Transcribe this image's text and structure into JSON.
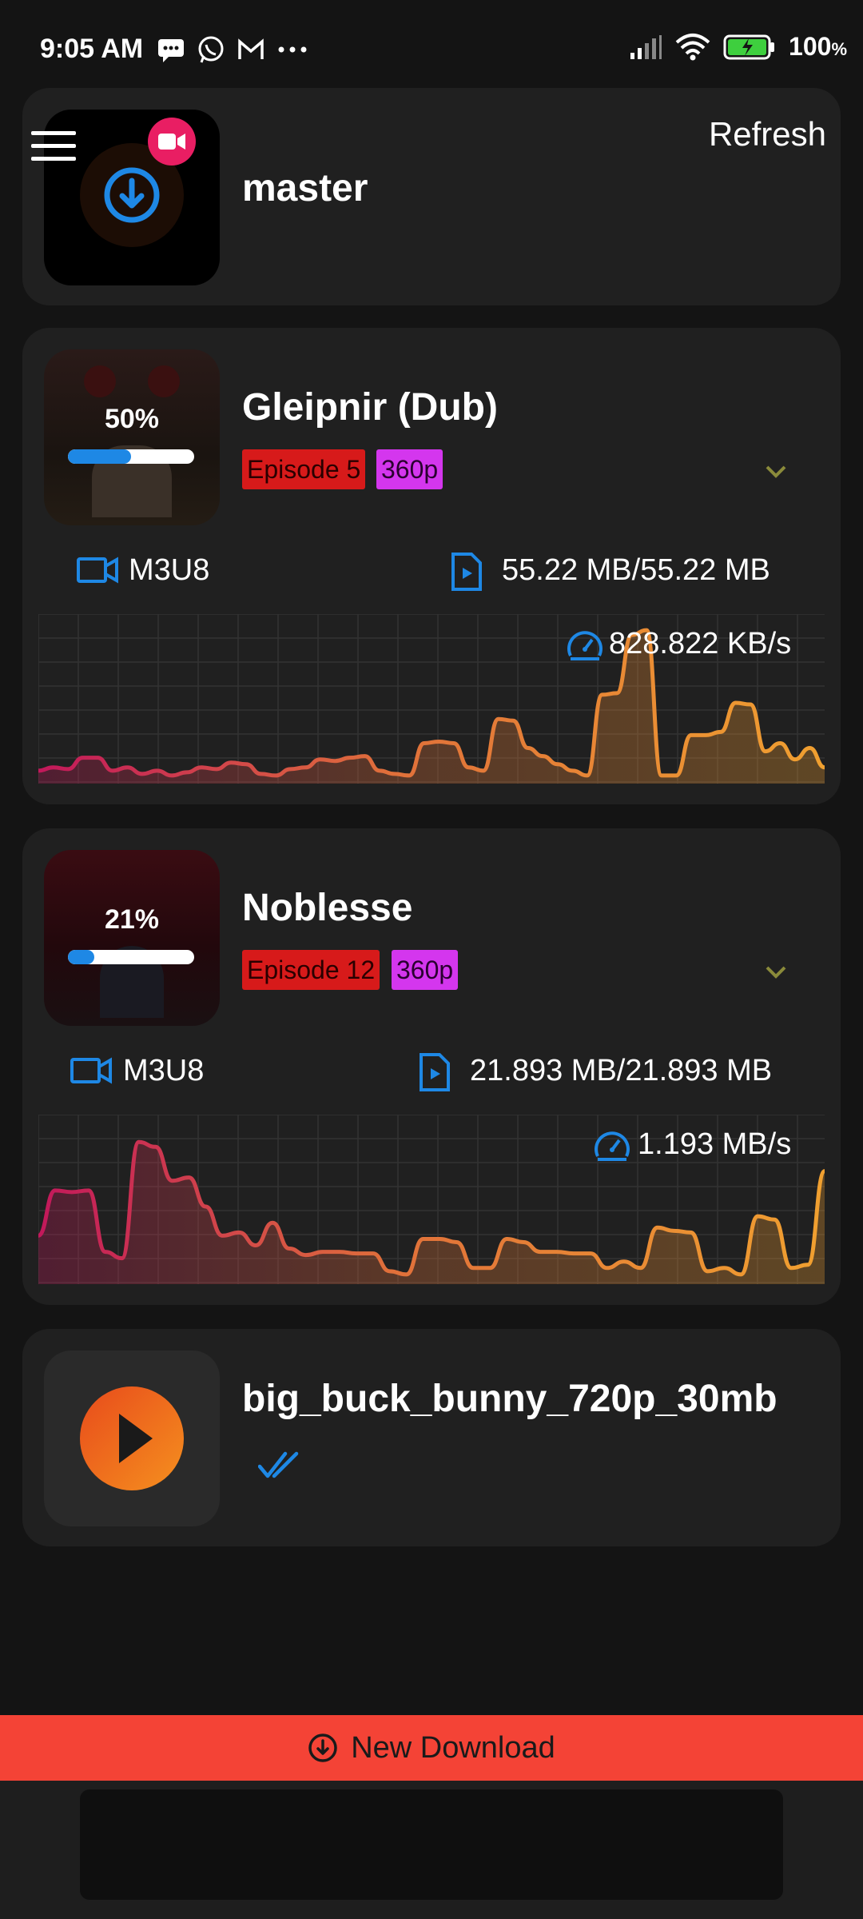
{
  "status_bar": {
    "time": "9:05 AM",
    "battery": "100",
    "battery_pct_sign": "%"
  },
  "header": {
    "title": "master",
    "refresh_label": "Refresh"
  },
  "downloads": [
    {
      "title": "Gleipnir (Dub)",
      "progress_pct": 50,
      "progress_label": "50%",
      "episode": "Episode 5",
      "quality": "360p",
      "format": "M3U8",
      "size": "55.22 MB/55.22 MB",
      "speed": "828.822 KB/s",
      "speed_history": [
        8,
        10,
        9,
        16,
        16,
        8,
        10,
        6,
        8,
        5,
        7,
        10,
        9,
        13,
        12,
        6,
        5,
        9,
        10,
        15,
        14,
        16,
        17,
        8,
        6,
        5,
        25,
        26,
        25,
        10,
        8,
        40,
        39,
        22,
        17,
        12,
        8,
        5,
        55,
        56,
        92,
        95,
        5,
        5,
        30,
        30,
        32,
        50,
        49,
        20,
        25,
        15,
        22,
        10
      ]
    },
    {
      "title": "Noblesse",
      "progress_pct": 21,
      "progress_label": "21%",
      "episode": "Episode 12",
      "quality": "360p",
      "format": "M3U8",
      "size": "21.893 MB/21.893 MB",
      "speed": "1.193 MB/s",
      "speed_history": [
        30,
        58,
        57,
        58,
        20,
        16,
        88,
        85,
        64,
        66,
        48,
        30,
        32,
        24,
        38,
        22,
        18,
        20,
        20,
        19,
        19,
        8,
        6,
        28,
        28,
        26,
        10,
        10,
        28,
        26,
        20,
        20,
        19,
        19,
        10,
        14,
        10,
        35,
        33,
        32,
        8,
        10,
        6,
        42,
        40,
        10,
        12,
        70
      ]
    },
    {
      "title": "big_buck_bunny_720p_30mb",
      "status_icon": "double-check-icon"
    }
  ],
  "actions": {
    "new_download_label": "New Download"
  },
  "colors": {
    "accent_blue": "#1e88e5",
    "orange": "#f0a030",
    "magenta": "#c2185b",
    "red_bar": "#f44336"
  }
}
